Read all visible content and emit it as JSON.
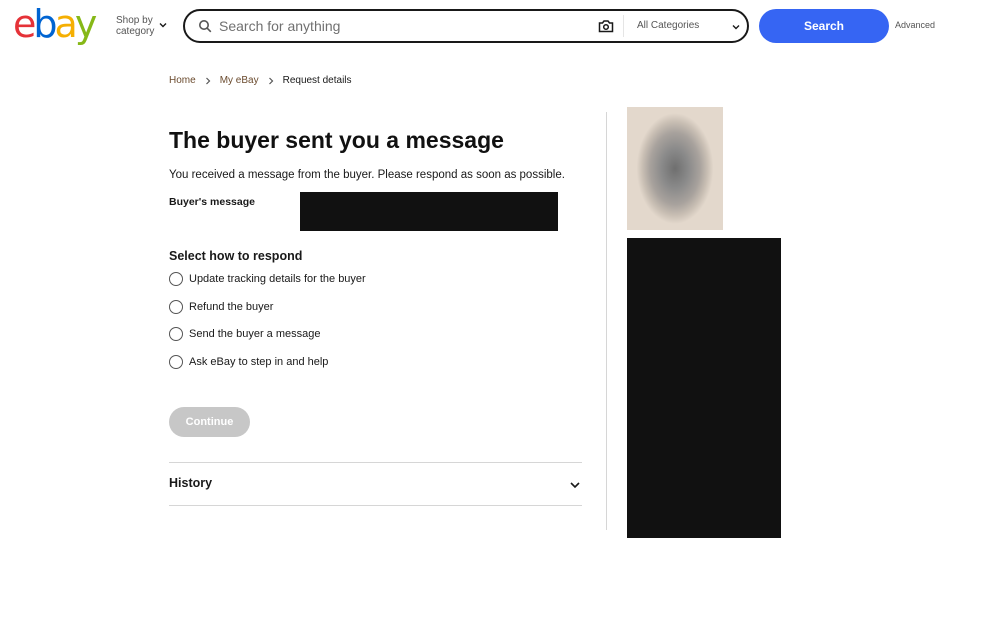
{
  "header": {
    "logo_letters": [
      {
        "char": "e",
        "color": "#e53238"
      },
      {
        "char": "b",
        "color": "#0064d2"
      },
      {
        "char": "a",
        "color": "#f5af02"
      },
      {
        "char": "y",
        "color": "#86b817"
      }
    ],
    "shop_by_line1": "Shop by",
    "shop_by_line2": "category",
    "search_placeholder": "Search for anything",
    "category_select": "All Categories",
    "search_button": "Search",
    "advanced_link": "Advanced"
  },
  "breadcrumb": [
    {
      "label": "Home"
    },
    {
      "label": "My eBay"
    },
    {
      "label": "Request details"
    }
  ],
  "main": {
    "title": "The buyer sent you a message",
    "subtitle": "You received a message from the buyer. Please respond as soon as possible.",
    "buyer_message_label": "Buyer's message",
    "respond_heading": "Select how to respond",
    "options": [
      "Update tracking details for the buyer",
      "Refund the buyer",
      "Send the buyer a message",
      "Ask eBay to step in and help"
    ],
    "continue_button": "Continue",
    "history_label": "History"
  },
  "colors": {
    "accent": "#3665f3",
    "breadcrumb_link": "#6b4b2e",
    "disabled_button": "#c7c7c7"
  }
}
